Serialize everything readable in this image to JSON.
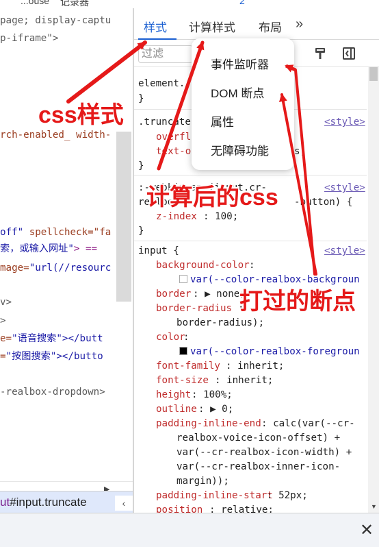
{
  "top_strip": {
    "frag1": "...ouse",
    "frag2": "记录器",
    "count": "2"
  },
  "elements_panel": {
    "lines": [
      {
        "pre": "",
        "attr": "page; display-captu",
        "rest": ""
      },
      {
        "pre": "",
        "attr": "p-iframe\">",
        "rest": ""
      },
      {
        "pre": "",
        "attr": "",
        "rest": ""
      },
      {
        "pre": "",
        "attr": "",
        "rest": ""
      },
      {
        "pre": "",
        "attr": "",
        "rest": ""
      },
      {
        "pre": "",
        "attr": "",
        "rest": ""
      },
      {
        "pre": "",
        "attr": "",
        "rest": ""
      },
      {
        "pre": "",
        "attr": "",
        "rest": ""
      },
      {
        "pre": "rch-enabled_ width-",
        "attr": "",
        "rest": ""
      }
    ],
    "code_lines": [
      {
        "a": "off\"",
        "b": " spellcheck=\"fa"
      },
      {
        "a": "索，或输入网址\"",
        "b": "> =="
      },
      {
        "a": "mage=",
        "b": "\"url(//resourc"
      },
      {
        "a": "v>",
        "b": ""
      },
      {
        "a": ">",
        "b": ""
      },
      {
        "a": "e=",
        "b": "\"语音搜索\"></butt"
      },
      {
        "a": "=",
        "b": "\"按图搜索\"></butto"
      },
      {
        "a": "-realbox-dropdown>",
        "b": ""
      }
    ],
    "breadcrumb": {
      "prefix": "ut",
      "rest": "#input.truncate",
      "arrow": "‹"
    }
  },
  "tabs": {
    "styles": "样式",
    "computed": "计算样式",
    "layout": "布局",
    "more": "»"
  },
  "filter": {
    "placeholder": "过滤"
  },
  "menu": {
    "items": [
      "事件监听器",
      "DOM 断点",
      "属性",
      "无障碍功能"
    ]
  },
  "rules": {
    "element": {
      "sel": "element.",
      "close": "}"
    },
    "truncate": {
      "sel": ".truncate",
      "src": "<style>",
      "p1": "overfl",
      "p2": "text-o",
      "tail": "s;",
      "close": "}"
    },
    "webkit": {
      "line1": ":-webkit-any(input.cr-",
      "line2": "realbox",
      "line2b": "-button) {",
      "src": "<style>",
      "prop": "z-index",
      "val": ": 100;",
      "close": "}"
    },
    "input": {
      "sel": "input {",
      "src": "<style>",
      "decls": [
        {
          "p": "background-color",
          "v": ":"
        },
        {
          "p": "",
          "v": "var(--color-realbox-backgroun",
          "swatch": "#ffffff"
        },
        {
          "p": "border",
          "v": ": ▶ none;"
        },
        {
          "p": "border-radius",
          "v": ":"
        },
        {
          "p": "",
          "v": "border-radius);"
        },
        {
          "p": "color",
          "v": ":"
        },
        {
          "p": "",
          "v": "var(--color-realbox-foregroun",
          "swatch": "#000000"
        },
        {
          "p": "font-family",
          "v": ": inherit;"
        },
        {
          "p": "font-size",
          "v": ": inherit;"
        },
        {
          "p": "height",
          "v": ": 100%;"
        },
        {
          "p": "outline",
          "v": ": ▶ 0;"
        },
        {
          "p": "padding-inline-end",
          "v": ": calc(var(--cr-"
        },
        {
          "p": "",
          "v": "realbox-voice-icon-offset) +"
        },
        {
          "p": "",
          "v": "var(--cr-realbox-icon-width) +"
        },
        {
          "p": "",
          "v": "var(--cr-realbox-inner-icon-"
        },
        {
          "p": "",
          "v": "margin));"
        },
        {
          "p": "padding-inline-start",
          "v": ": 52px;"
        },
        {
          "p": "position",
          "v": ": relative;"
        }
      ]
    }
  },
  "annotations": {
    "css_styles": "css样式",
    "computed_css": "计算后的css",
    "breakpoints": "打过的断点"
  },
  "drawer": {
    "close": "✕"
  },
  "colors": {
    "accent": "#1a5fd1",
    "annotation": "#e51919",
    "breadcrumb_bg": "#dfe8fb"
  }
}
